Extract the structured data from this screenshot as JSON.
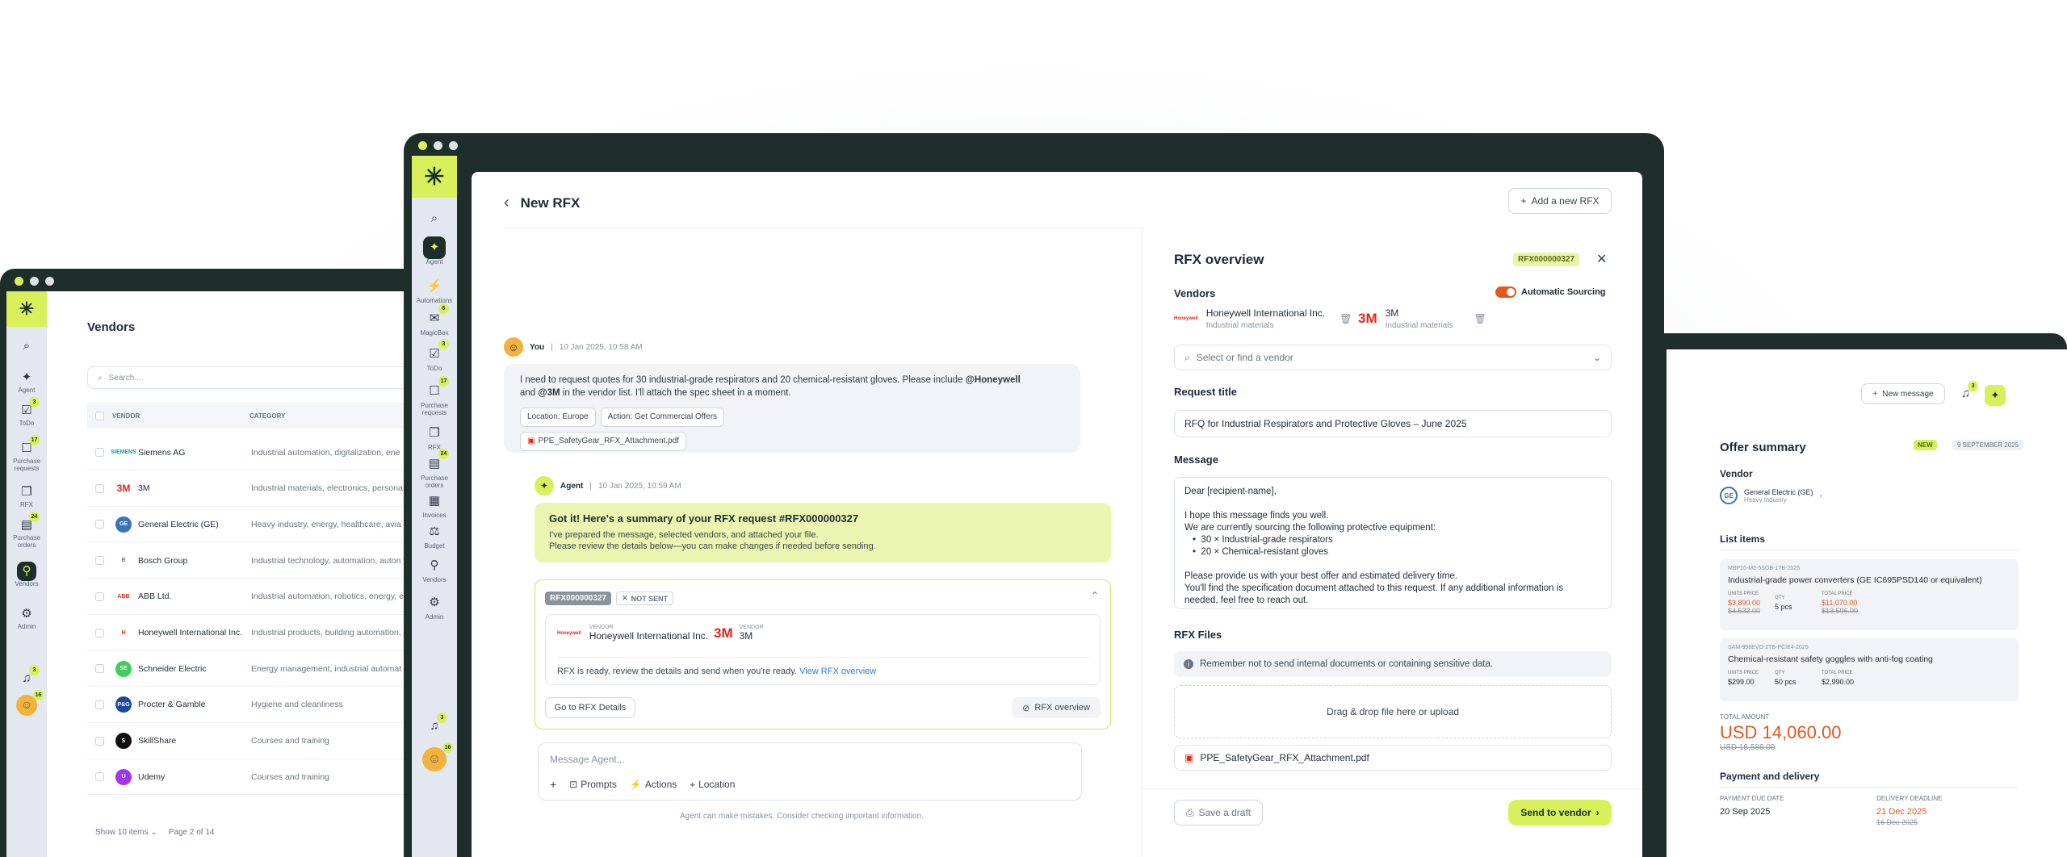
{
  "colors": {
    "accent": "#d8f15a",
    "dark": "#1f2d2b",
    "sidebar": "#e3e7f0",
    "orange": "#e2571e"
  },
  "left": {
    "page_title": "Vendors",
    "search_placeholder": "Search...",
    "col_vendor": "VENDOR",
    "col_category": "CATEGORY",
    "rows": [
      {
        "name": "Siemens AG",
        "category": "Industrial automation, digitalization, ene",
        "logo": "SIEMENS",
        "color": "#0f9aa6"
      },
      {
        "name": "3M",
        "category": "Industrial materials, electronics, persona",
        "logo": "3M",
        "color": "#e4261d"
      },
      {
        "name": "General Electric (GE)",
        "category": "Heavy industry, energy, healthcare, avia",
        "logo": "GE",
        "color": "#3b73b9"
      },
      {
        "name": "Bosch Group",
        "category": "Industrial technology, automation, auton",
        "logo": "B",
        "color": "#6b7280"
      },
      {
        "name": "ABB Ltd.",
        "category": "Industrial automation, robotics, energy, e",
        "logo": "ABB",
        "color": "#e4261d"
      },
      {
        "name": "Honeywell International Inc.",
        "category": "Industrial products, building automation,",
        "logo": "H",
        "color": "#e4261d"
      },
      {
        "name": "Schneider Electric",
        "category": "Energy management, industrial automat",
        "logo": "SE",
        "color": "#3dcd58"
      },
      {
        "name": "Procter & Gamble",
        "category": "Hygiene and cleanliness",
        "logo": "P&G",
        "color": "#1b4a9c"
      },
      {
        "name": "SkillShare",
        "category": "Courses and training",
        "logo": "S",
        "color": "#111111"
      },
      {
        "name": "Udemy",
        "category": "Courses and training",
        "logo": "U",
        "color": "#a435f0"
      }
    ],
    "show_items": "Show 10 items",
    "page_of": "Page 2 of 14",
    "nav": [
      {
        "label": "Agent",
        "icon": "agent-icon",
        "glyph": "✦"
      },
      {
        "label": "ToDo",
        "icon": "todo-icon",
        "glyph": "☑",
        "badge": "3"
      },
      {
        "label": "Purchase requests",
        "icon": "purchase-requests-icon",
        "glyph": "☐",
        "badge": "17"
      },
      {
        "label": "RFX",
        "icon": "rfx-icon",
        "glyph": "❐"
      },
      {
        "label": "Purchase orders",
        "icon": "purchase-orders-icon",
        "glyph": "▤",
        "badge": "24"
      },
      {
        "label": "Vendors",
        "icon": "vendors-icon",
        "glyph": "⚲"
      },
      {
        "label": "Admin",
        "icon": "admin-icon",
        "glyph": "⚙"
      }
    ],
    "bell_badge": "3",
    "avatar_badge": "16"
  },
  "main": {
    "back_title": "New RFX",
    "add_button": "Add a new RFX",
    "nav": [
      {
        "label": "",
        "icon": "search-icon",
        "glyph": "⌕"
      },
      {
        "label": "Agent",
        "icon": "agent-icon",
        "glyph": "✦",
        "active": true
      },
      {
        "label": "Automations",
        "icon": "automations-icon",
        "glyph": "⚡"
      },
      {
        "label": "MagicBox",
        "icon": "magicbox-icon",
        "glyph": "✉",
        "badge": "6"
      },
      {
        "label": "ToDo",
        "icon": "todo-icon",
        "glyph": "☑",
        "badge": "3"
      },
      {
        "label": "Purchase requests",
        "icon": "purchase-requests-icon",
        "glyph": "☐",
        "badge": "17"
      },
      {
        "label": "RFX",
        "icon": "rfx-icon",
        "glyph": "❐"
      },
      {
        "label": "Purchase orders",
        "icon": "purchase-orders-icon",
        "glyph": "▤",
        "badge": "24"
      },
      {
        "label": "Invoices",
        "icon": "invoices-icon",
        "glyph": "▦"
      },
      {
        "label": "Budget",
        "icon": "budget-icon",
        "glyph": "⚖"
      },
      {
        "label": "Vendors",
        "icon": "vendors-icon",
        "glyph": "⚲"
      },
      {
        "label": "Admin",
        "icon": "admin-icon",
        "glyph": "⚙"
      }
    ],
    "bell_badge": "3",
    "avatar_badge": "16",
    "chat": {
      "user_name": "You",
      "user_time": "10 Jan 2025, 10:58 AM",
      "user_msg_1": "I need to request quotes for 30 industrial-grade respirators and 20 chemical-resistant gloves. Please include ",
      "mention_1": "@Honeywell",
      "user_msg_2": "and ",
      "mention_2": "@3M",
      "user_msg_3": " in the vendor list. I'll attach the spec sheet in a moment.",
      "chip_location": "Location: Europe",
      "chip_action": "Action: Get Commercial Offers",
      "attachment": "PPE_SafetyGear_RFX_Attachment.pdf",
      "agent_name": "Agent",
      "agent_time": "10 Jan 2025, 10:59 AM",
      "agent_title": "Got it! Here's a summary of your RFX request #RFX000000327",
      "agent_line1": "I've prepared the message, selected vendors, and attached your file.",
      "agent_line2": "Please review the details below—you can make changes if needed before sending.",
      "card_id": "RFX000000327",
      "card_status": "NOT SENT",
      "vendor_label": "VENDOR",
      "vendor1": "Honeywell International Inc.",
      "vendor2": "3M",
      "ready_text": "RFX is ready, review the details and send when you're ready.",
      "view_link": "View RFX overview",
      "go_details": "Go to RFX Details",
      "rfx_overview_btn": "RFX overview",
      "composer_placeholder": "Message Agent...",
      "prompts": "Prompts",
      "actions": "Actions",
      "location": "Location",
      "disclaimer": "Agent can make mistakes. Consider checking important information."
    },
    "overview": {
      "title": "RFX overview",
      "id": "RFX000000327",
      "vendors_label": "Vendors",
      "auto_sourcing": "Automatic Sourcing",
      "v1_name": "Honeywell International Inc.",
      "v1_cat": "Industrial materials",
      "v2_name": "3M",
      "v2_cat": "Industrial materials",
      "vendor_select": "Select or find a vendor",
      "request_title_label": "Request title",
      "request_title": "RFQ for Industrial Respirators and Protective Gloves – June 2025",
      "message_label": "Message",
      "msg_greeting": "Dear [recipient-name],",
      "msg_l1": "I hope this message finds you well.",
      "msg_l2": "We are currently sourcing the following protective equipment:",
      "msg_b1": "30 × Industrial-grade respirators",
      "msg_b2": "20 × Chemical-resistant gloves",
      "msg_l3": "Please provide us with your best offer and estimated delivery time.",
      "msg_l4": "You'll find the specification document attached to this request. If any additional information is",
      "msg_l5": "needed, feel free to reach out.",
      "files_label": "RFX Files",
      "files_note": "Remember not to send internal documents or containing sensitive data.",
      "dropzone": "Drag & drop file here or upload",
      "file": "PPE_SafetyGear_RFX_Attachment.pdf",
      "save_draft": "Save a draft",
      "send": "Send to vendor"
    }
  },
  "right": {
    "new_message": "New message",
    "bell_badge": "3",
    "title": "Offer summary",
    "badge_new": "NEW",
    "date": "9 SEPTEMBER 2025",
    "vendor_label": "Vendor",
    "vendor_name": "General Electric (GE)",
    "vendor_cat": "Heavy industry",
    "list_label": "List items",
    "items": [
      {
        "sku": "MBP16-M2-5SGB-1TB-2025",
        "name": "Industrial-grade power converters (GE IC695PSD140 or equivalent)",
        "unit_label": "UNITS PRICE",
        "unit": "$3,890.00",
        "unit_old": "$4,532.00",
        "qty_label": "QTY",
        "qty": "5 pcs",
        "total_label": "TOTAL PRICE",
        "total": "$11,070.00",
        "total_old": "$13,596.00",
        "highlight": true
      },
      {
        "sku": "SAM-998EVO-2TB-PCIE4-2025",
        "name": "Chemical-resistant safety goggles with anti-fog coating",
        "unit_label": "UNITS PRICE",
        "unit": "$299.00",
        "unit_old": "",
        "qty_label": "QTY",
        "qty": "50 pcs",
        "total_label": "TOTAL PRICE",
        "total": "$2,990.00",
        "total_old": "",
        "highlight": false
      }
    ],
    "total_label": "TOTAL AMOUNT",
    "total": "USD 14,060.00",
    "total_old": "USD 16,586.00",
    "payment_label": "Payment and delivery",
    "pay_due_label": "PAYMENT DUE DATE",
    "pay_due": "20 Sep 2025",
    "delivery_label": "DELIVERY DEADLINE",
    "delivery": "21 Dec 2025",
    "delivery_old": "16 Dec 2025"
  }
}
